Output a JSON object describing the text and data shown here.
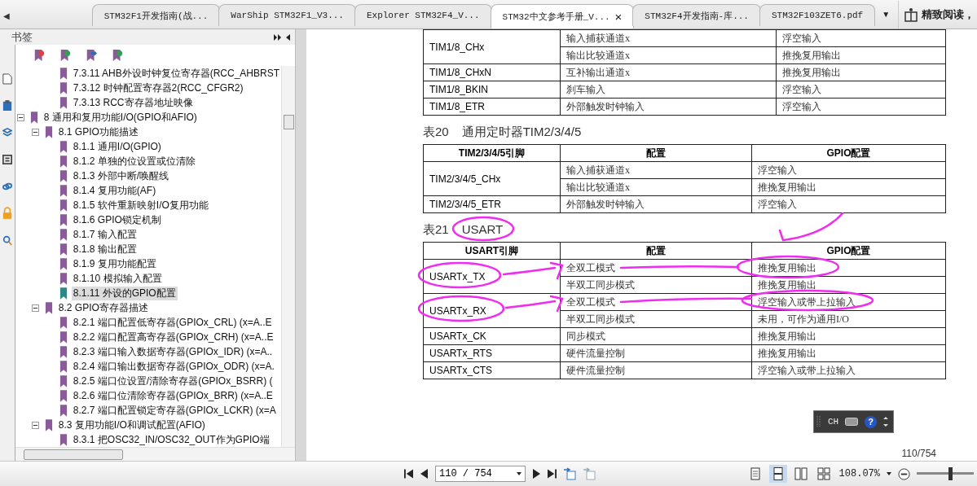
{
  "tabs": {
    "scroll_left": "◀",
    "menu": "▼",
    "close_symbol": "×",
    "items": [
      {
        "label": "STM32F1开发指南(战...",
        "selected": false
      },
      {
        "label": "WarShip STM32F1_V3...",
        "selected": false
      },
      {
        "label": "Explorer STM32F4_V...",
        "selected": false
      },
      {
        "label": "STM32中文参考手册_V...",
        "selected": true
      },
      {
        "label": "STM32F4开发指南-库...",
        "selected": false
      },
      {
        "label": "STM32F103ZET6.pdf",
        "selected": false
      }
    ],
    "reading_mode": "精致阅读，"
  },
  "sidebar": {
    "title": "书签",
    "tree": {
      "continued_children": [
        {
          "label": "7.3.11 AHB外设时钟复位寄存器(RCC_AHBRST",
          "selected": false
        },
        {
          "label": "7.3.12 时钟配置寄存器2(RCC_CFGR2)",
          "selected": false
        },
        {
          "label": "7.3.13 RCC寄存器地址映像",
          "selected": false
        }
      ],
      "items": [
        {
          "label": "8 通用和复用功能I/O(GPIO和AFIO)",
          "selected": false,
          "expanded": true,
          "children": [
            {
              "label": "8.1 GPIO功能描述",
              "selected": false,
              "expanded": true,
              "children": [
                {
                  "label": "8.1.1 通用I/O(GPIO)",
                  "selected": false
                },
                {
                  "label": "8.1.2 单独的位设置或位清除",
                  "selected": false
                },
                {
                  "label": "8.1.3 外部中断/唤醒线",
                  "selected": false
                },
                {
                  "label": "8.1.4 复用功能(AF)",
                  "selected": false
                },
                {
                  "label": "8.1.5 软件重新映射I/O复用功能",
                  "selected": false
                },
                {
                  "label": "8.1.6 GPIO锁定机制",
                  "selected": false
                },
                {
                  "label": "8.1.7 输入配置",
                  "selected": false
                },
                {
                  "label": "8.1.8 输出配置",
                  "selected": false
                },
                {
                  "label": "8.1.9 复用功能配置",
                  "selected": false
                },
                {
                  "label": "8.1.10 模拟输入配置",
                  "selected": false
                },
                {
                  "label": "8.1.11 外设的GPIO配置",
                  "selected": true
                }
              ]
            },
            {
              "label": "8.2 GPIO寄存器描述",
              "selected": false,
              "expanded": true,
              "children": [
                {
                  "label": "8.2.1 端口配置低寄存器(GPIOx_CRL) (x=A..E",
                  "selected": false
                },
                {
                  "label": "8.2.2 端口配置高寄存器(GPIOx_CRH) (x=A..E",
                  "selected": false
                },
                {
                  "label": "8.2.3 端口输入数据寄存器(GPIOx_IDR) (x=A..",
                  "selected": false
                },
                {
                  "label": "8.2.4 端口输出数据寄存器(GPIOx_ODR) (x=A.",
                  "selected": false
                },
                {
                  "label": "8.2.5 端口位设置/清除寄存器(GPIOx_BSRR) (",
                  "selected": false
                },
                {
                  "label": "8.2.6 端口位清除寄存器(GPIOx_BRR) (x=A..E",
                  "selected": false
                },
                {
                  "label": "8.2.7 端口配置锁定寄存器(GPIOx_LCKR) (x=A",
                  "selected": false
                }
              ]
            },
            {
              "label": "8.3 复用功能I/O和调试配置(AFIO)",
              "selected": false,
              "expanded": true,
              "children": [
                {
                  "label": "8.3.1 把OSC32_IN/OSC32_OUT作为GPIO端",
                  "selected": false
                }
              ]
            }
          ]
        }
      ]
    }
  },
  "document": {
    "tables": [
      {
        "rows": [
          {
            "pin": "TIM1/8_CHx",
            "configs": [
              {
                "mode": "输入捕获通道x",
                "gpio": "浮空输入"
              },
              {
                "mode": "输出比较通道x",
                "gpio": "推挽复用输出"
              }
            ]
          },
          {
            "pin": "TIM1/8_CHxN",
            "configs": [
              {
                "mode": "互补输出通道x",
                "gpio": "推挽复用输出"
              }
            ]
          },
          {
            "pin": "TIM1/8_BKIN",
            "configs": [
              {
                "mode": "刹车输入",
                "gpio": "浮空输入"
              }
            ]
          },
          {
            "pin": "TIM1/8_ETR",
            "configs": [
              {
                "mode": "外部触发时钟输入",
                "gpio": "浮空输入"
              }
            ]
          }
        ]
      },
      {
        "caption_number": "表20",
        "caption_title": "通用定时器TIM2/3/4/5",
        "header": [
          "TIM2/3/4/5引脚",
          "配置",
          "GPIO配置"
        ],
        "rows": [
          {
            "pin": "TIM2/3/4/5_CHx",
            "configs": [
              {
                "mode": "输入捕获通道x",
                "gpio": "浮空输入"
              },
              {
                "mode": "输出比较通道x",
                "gpio": "推挽复用输出"
              }
            ]
          },
          {
            "pin": "TIM2/3/4/5_ETR",
            "configs": [
              {
                "mode": "外部触发时钟输入",
                "gpio": "浮空输入"
              }
            ]
          }
        ]
      },
      {
        "caption_number": "表21",
        "caption_title": "USART",
        "header": [
          "USART引脚",
          "配置",
          "GPIO配置"
        ],
        "rows": [
          {
            "pin": "USARTx_TX",
            "configs": [
              {
                "mode": "全双工模式",
                "gpio": "推挽复用输出"
              },
              {
                "mode": "半双工同步模式",
                "gpio": "推挽复用输出"
              }
            ]
          },
          {
            "pin": "USARTx_RX",
            "configs": [
              {
                "mode": "全双工模式",
                "gpio": "浮空输入或带上拉输入"
              },
              {
                "mode": "半双工同步模式",
                "gpio": "未用，可作为通用I/O"
              }
            ]
          },
          {
            "pin": "USARTx_CK",
            "configs": [
              {
                "mode": "同步模式",
                "gpio": "推挽复用输出"
              }
            ]
          },
          {
            "pin": "USARTx_RTS",
            "configs": [
              {
                "mode": "硬件流量控制",
                "gpio": "推挽复用输出"
              }
            ]
          },
          {
            "pin": "USARTx_CTS",
            "configs": [
              {
                "mode": "硬件流量控制",
                "gpio": "浮空输入或带上拉输入"
              }
            ]
          }
        ]
      }
    ],
    "page_number": "110/754"
  },
  "ime_bar": {
    "language": "CH",
    "help": "?"
  },
  "toolbar": {
    "page_field": "110 / 754",
    "view_modes": [
      {
        "selected": false
      },
      {
        "selected": true
      },
      {
        "selected": false
      },
      {
        "selected": false
      }
    ],
    "zoom": "108.07%",
    "zoom_slider": {
      "level": 0.6
    }
  }
}
